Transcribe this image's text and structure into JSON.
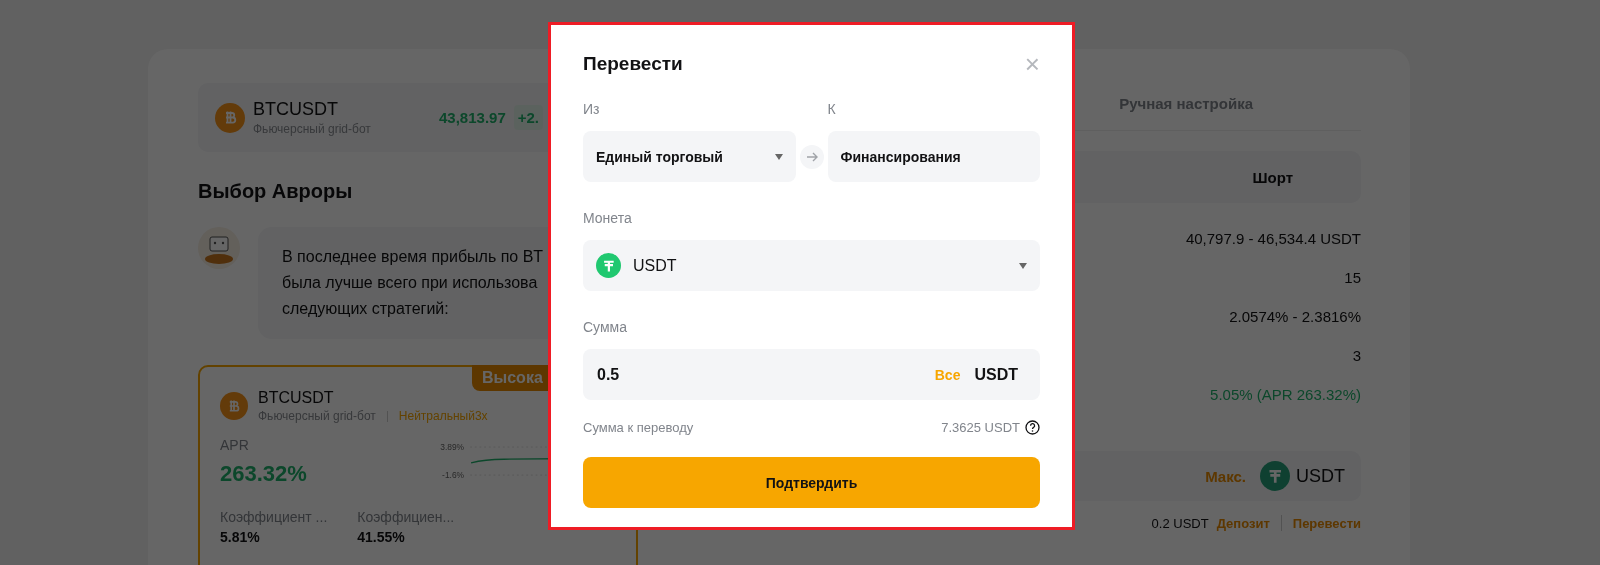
{
  "background": {
    "ticker": {
      "symbol": "BTCUSDT",
      "subtitle": "Фьючерсный grid-бот",
      "price": "43,813.97",
      "change": "+2."
    },
    "section_title": "Выбор Авроры",
    "assistant_message": [
      "В последнее время прибыль по BT",
      "была лучше всего при использова",
      "следующих стратегий:"
    ],
    "strategy_card": {
      "badge": "Высока",
      "symbol": "BTCUSDT",
      "subtitle": "Фьючерсный grid-бот",
      "mode": "Нейтральный3x",
      "apr_label": "APR",
      "apr_value": "263.32%",
      "chart_labels": [
        "3.89%",
        "-1.6%"
      ],
      "stats": [
        {
          "label": "Коэффициент ...",
          "value": "5.81%"
        },
        {
          "label": "Коэффициен...",
          "value": "41.55%"
        }
      ]
    },
    "tabs": [
      {
        "label": "Ручная настройка",
        "selected": false
      }
    ],
    "direction": [
      {
        "label": "Шорт",
        "selected": false
      }
    ],
    "values": [
      {
        "text": "40,797.9 - 46,534.4 USDT",
        "positive": false
      },
      {
        "text": "15",
        "positive": false
      },
      {
        "text": "2.0574% - 2.3816%",
        "positive": false
      },
      {
        "text": "3",
        "positive": false
      },
      {
        "text": "5.05% (APR 263.32%)",
        "positive": true
      }
    ],
    "investment": {
      "max": "Макс.",
      "currency": "USDT"
    },
    "balance": {
      "amount": "0.2 USDT",
      "links": [
        "Депозит",
        "Перевести"
      ]
    }
  },
  "modal": {
    "title": "Перевести",
    "close": "×",
    "from": {
      "label": "Из",
      "value": "Единый торговый"
    },
    "to": {
      "label": "К",
      "value": "Финансирования"
    },
    "coin": {
      "label": "Монета",
      "value": "USDT"
    },
    "amount": {
      "label": "Сумма",
      "value": "0.5",
      "all": "Все",
      "currency": "USDT"
    },
    "transfer": {
      "label": "Сумма к переводу",
      "value": "7.3625 USDT"
    },
    "confirm": "Подтвердить"
  }
}
